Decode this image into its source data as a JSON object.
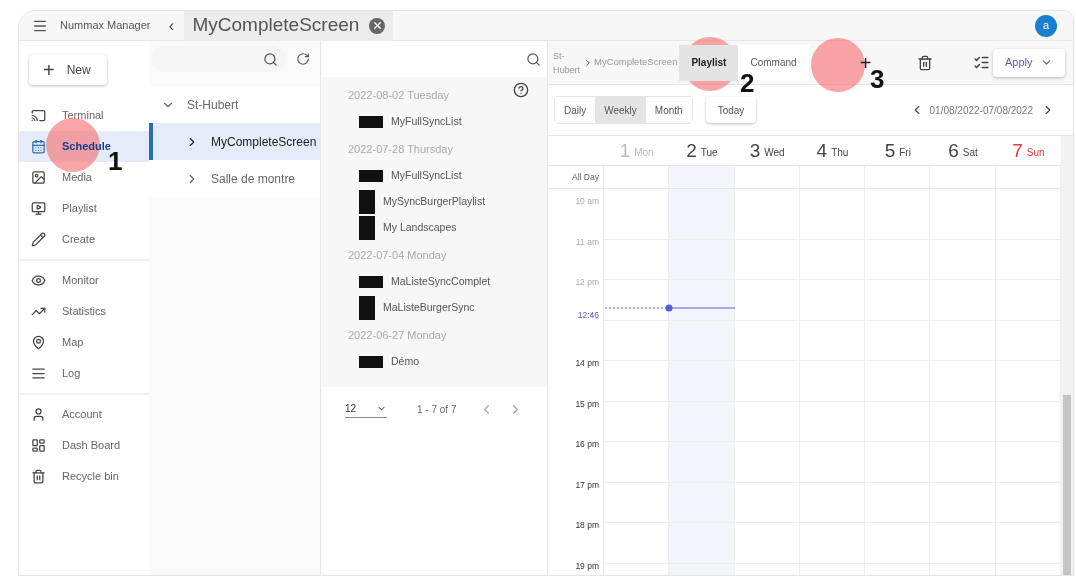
{
  "top_bar": {
    "app_name": "Nummax Manager",
    "back": "‹",
    "screen_tab": {
      "title": "MyCompleteScreen"
    },
    "avatar": "a"
  },
  "sidebar": {
    "new_button": {
      "plus": "+",
      "label": "New"
    },
    "groups": [
      [
        {
          "label": "Terminal",
          "selected": false
        },
        {
          "label": "Schedule",
          "selected": true
        },
        {
          "label": "Media",
          "selected": false
        },
        {
          "label": "Playlist",
          "selected": false
        },
        {
          "label": "Create",
          "selected": false
        }
      ],
      [
        {
          "label": "Monitor",
          "selected": false
        },
        {
          "label": "Statistics",
          "selected": false
        },
        {
          "label": "Map",
          "selected": false
        },
        {
          "label": "Log",
          "selected": false
        }
      ],
      [
        {
          "label": "Account",
          "selected": false
        },
        {
          "label": "Dash Board",
          "selected": false
        },
        {
          "label": "Recycle bin",
          "selected": false
        }
      ]
    ]
  },
  "tree": {
    "items": [
      {
        "label": "St-Hubert",
        "expanded": true,
        "selected": false,
        "children": [
          {
            "label": "MyCompleteScreen",
            "expanded": false,
            "selected": true
          },
          {
            "label": "Salle de montre",
            "expanded": false,
            "selected": false
          }
        ]
      }
    ]
  },
  "playlists": {
    "groups": [
      {
        "date": "2022-08-02 Tuesday",
        "items": [
          {
            "name": "MyFullSyncList",
            "kind": "wide"
          }
        ]
      },
      {
        "date": "2022-07-28 Thursday",
        "items": [
          {
            "name": "MyFullSyncList",
            "kind": "wide"
          },
          {
            "name": "MySyncBurgerPlaylist",
            "kind": "tall"
          },
          {
            "name": "My Landscapes",
            "kind": "tall"
          }
        ]
      },
      {
        "date": "2022-07-04 Monday",
        "items": [
          {
            "name": "MaListeSyncComplet",
            "kind": "wide"
          },
          {
            "name": "MaListeBurgerSync",
            "kind": "tall"
          }
        ]
      },
      {
        "date": "2022-06-27 Monday",
        "items": [
          {
            "name": "Démo",
            "kind": "wide"
          }
        ]
      }
    ],
    "page_size": "12",
    "range": "1 - 7 of 7"
  },
  "schedule": {
    "breadcrumb": [
      "St-Hubert",
      "MyCompleteScreen"
    ],
    "tabs": [
      {
        "label": "Playlist",
        "selected": true
      },
      {
        "label": "Command",
        "selected": false
      }
    ],
    "add": "+",
    "apply": "Apply",
    "views": [
      {
        "label": "Daily",
        "selected": false
      },
      {
        "label": "Weekly",
        "selected": true
      },
      {
        "label": "Month",
        "selected": false
      }
    ],
    "today": "Today",
    "range": "01/08/2022-07/08/2022",
    "days": [
      {
        "number": "1",
        "name": "Mon",
        "kind": "past"
      },
      {
        "number": "2",
        "name": "Tue",
        "kind": "today"
      },
      {
        "number": "3",
        "name": "Wed",
        "kind": "normal"
      },
      {
        "number": "4",
        "name": "Thu",
        "kind": "normal"
      },
      {
        "number": "5",
        "name": "Fri",
        "kind": "normal"
      },
      {
        "number": "6",
        "name": "Sat",
        "kind": "normal"
      },
      {
        "number": "7",
        "name": "Sun",
        "kind": "sunday"
      }
    ],
    "all_day": "All Day",
    "hours": [
      {
        "label": "10 am",
        "kind": "past"
      },
      {
        "label": "11 am",
        "kind": "past"
      },
      {
        "label": "12 pm",
        "kind": "past"
      },
      {
        "label": "12:46",
        "kind": "now"
      },
      {
        "label": "14 pm",
        "kind": "future"
      },
      {
        "label": "15 pm",
        "kind": "future"
      },
      {
        "label": "16 pm",
        "kind": "future"
      },
      {
        "label": "17 pm",
        "kind": "future"
      },
      {
        "label": "18 pm",
        "kind": "future"
      },
      {
        "label": "19 pm",
        "kind": "future"
      }
    ]
  },
  "callouts": [
    {
      "number": "1"
    },
    {
      "number": "2"
    },
    {
      "number": "3"
    }
  ]
}
